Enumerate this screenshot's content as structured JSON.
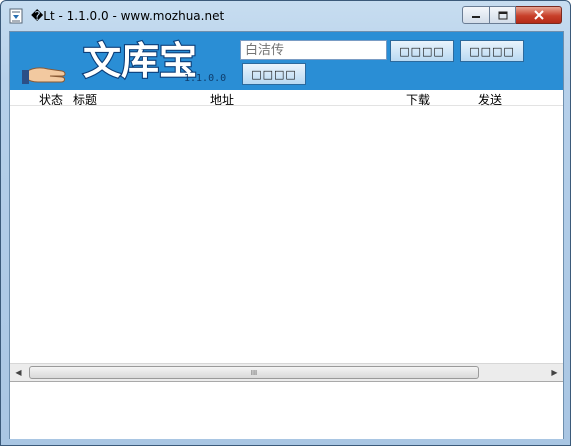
{
  "window": {
    "title": "�Lt - 1.1.0.0 - www.mozhua.net"
  },
  "banner": {
    "logo_text": "文库宝",
    "version": "1.1.0.0",
    "search": {
      "value": "",
      "placeholder": "白洁传"
    },
    "buttons": [
      "□□□□",
      "□□□□",
      "□□□□"
    ]
  },
  "list": {
    "columns": [
      "状态",
      "标题",
      "地址",
      "下载",
      "发送"
    ],
    "rows": []
  },
  "scrollbar": {
    "grip": "III"
  },
  "colors": {
    "banner": "#2a8ed5",
    "logo_fill": "#ffffff",
    "logo_outline": "#0b3d78",
    "button_bg": "#cfe6f8"
  },
  "icons": [
    "app-icon",
    "minimize-icon",
    "maximize-icon",
    "close-icon",
    "hand-icon",
    "arrow-left-icon",
    "arrow-right-icon"
  ]
}
